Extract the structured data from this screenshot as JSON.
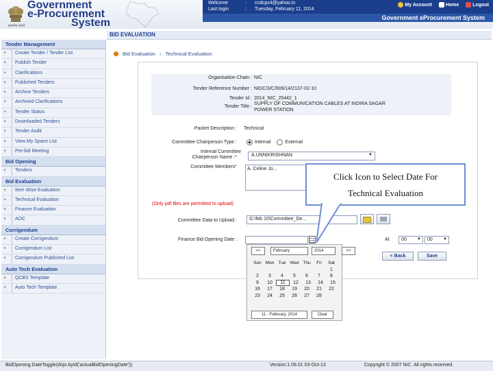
{
  "header": {
    "brand_line1": "Government",
    "brand_line2": "e-Procurement",
    "brand_line3": "System",
    "emblem_caption": "सत्यमेव जयते",
    "welcome_label": "Welcome",
    "welcome_value": "ccdcps4@yahoo.in",
    "lastlogin_label": "Last login",
    "lastlogin_value": "Tuesday, February 11, 2014",
    "colon": ":",
    "my_account": "My Account",
    "home": "Home",
    "logout": "Logout",
    "system_title": "Government eProcurement System"
  },
  "sidebar": {
    "sections": [
      {
        "title": "Tender Management",
        "items": [
          "Create Tender / Tender List",
          "Publish Tender",
          "Clarifications",
          "Published Tenders",
          "Archive Tenders",
          "Archived Clarifications",
          "Tender Status",
          "Downloaded Tenders",
          "Tender Audit",
          "View My Space List",
          "Pre-bid Meeting"
        ]
      },
      {
        "title": "Bid Opening",
        "items": [
          "Tenders"
        ]
      },
      {
        "title": "Bid Evaluation",
        "items": [
          "Item Wise Evaluation",
          "Technical Evaluation",
          "Finance Evaluation",
          "AOC"
        ]
      },
      {
        "title": "Corrigendum",
        "items": [
          "Create Corrigendum",
          "Corrigendum List",
          "Corrigendum Published List"
        ]
      },
      {
        "title": "Auto Tech Evaluation",
        "items": [
          "QCBS Template",
          "Auto Tech Template"
        ]
      }
    ]
  },
  "page": {
    "section_title": "BID EVALUATION",
    "breadcrumb_1": "Bid Evaluation",
    "breadcrumb_sep": "›",
    "breadcrumb_2": "Technical Evaluation"
  },
  "info": {
    "org_label": "Organisation Chain :",
    "org_value": "NIC",
    "ref_label": "Tender Reference Number :",
    "ref_value": "NIDC/3/C/909/14/2137-02-10",
    "id_label": "Tender Id :",
    "id_value": "2014_NIC_25442_1",
    "title_label": "Tender Title :",
    "title_value_1": "SUPPLY OF COMMUNICATION CABLES AT INDIRA SAGAR",
    "title_value_2": "POWER STATION"
  },
  "form": {
    "packet_label": "Packet Description :",
    "packet_value": "Technical",
    "chair_label": "Committee Chairperson Type :",
    "chair_opt1": "Internal",
    "chair_opt2": "External",
    "icname_label_1": "Internal Committee",
    "icname_label_2": "Chairperson Name :",
    "icname_value": "A.UNNIKRISHNAN",
    "members_label": "Committee Members",
    "members_value": "A. Celine Jo...",
    "pdf_note": "(Only pdf files are permitted to upload)",
    "upload_label": "Committee Data to Upload :",
    "upload_value": "G:\\feb 10\\Committee_De...",
    "finance_label": "Finance Bid Opening Date :",
    "at_label": "At",
    "hh_value": "00",
    "mm_value": "00",
    "back_button": "< Back",
    "save_button": "Save"
  },
  "calendar": {
    "prev": "<<",
    "next": ">>",
    "month": "February",
    "year": "2014",
    "days": [
      "Sun",
      "Mon",
      "Tue",
      "Wed",
      "Thu",
      "Fri",
      "Sat"
    ],
    "weeks": [
      [
        "",
        "",
        "",
        "",
        "",
        "",
        "1"
      ],
      [
        "2",
        "3",
        "4",
        "5",
        "6",
        "7",
        "8"
      ],
      [
        "9",
        "10",
        "11",
        "12",
        "13",
        "14",
        "15"
      ],
      [
        "16",
        "17",
        "18",
        "19",
        "20",
        "21",
        "22"
      ],
      [
        "23",
        "24",
        "25",
        "26",
        "27",
        "28",
        ""
      ]
    ],
    "today_text": "11 - February, 2014",
    "clear": "Clear"
  },
  "callout": {
    "line1": "Click Icon to Select Date For",
    "line2": "Technical Evaluation"
  },
  "status": {
    "left": "BidOpening.DateToggle(dojo.byId('actualBidOpeningDate'));",
    "version": "Version:1.09.01 03-Oct-13",
    "copyright": "Copyright © 2007 NIC. All rights reserved."
  }
}
